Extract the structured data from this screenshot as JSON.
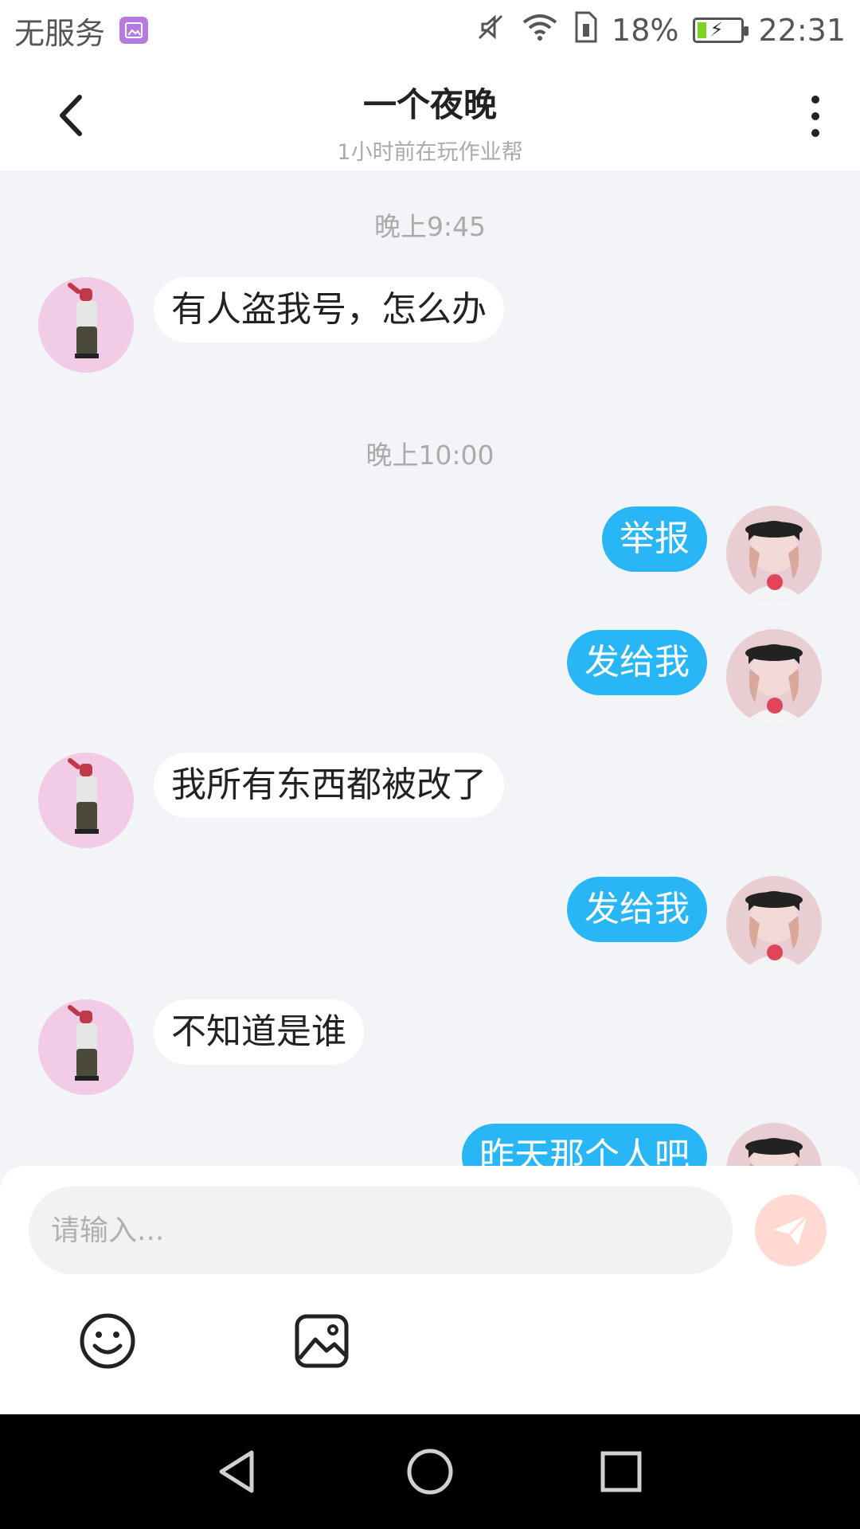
{
  "status_bar": {
    "carrier": "无服务",
    "battery": "18%",
    "time": "22:31",
    "battery_level": 0.18,
    "icons": [
      "gallery-icon",
      "mute-icon",
      "wifi-icon",
      "sim-icon",
      "battery-charging-icon"
    ]
  },
  "header": {
    "title": "一个夜晚",
    "subtitle": "1小时前在玩作业帮"
  },
  "messages": {
    "t1": {
      "time": "晚上9:45"
    },
    "m1": {
      "text": "有人盗我号，怎么办"
    },
    "t2": {
      "time": "晚上10:00"
    },
    "m2": {
      "text": "举报"
    },
    "m3": {
      "text": "发给我"
    },
    "m4": {
      "text": "我所有东西都被改了"
    },
    "m5": {
      "text": "发给我"
    },
    "m6": {
      "text": "不知道是谁"
    },
    "m7": {
      "text": "昨天那个人吧"
    }
  },
  "composer": {
    "placeholder": "请输入...",
    "value": ""
  },
  "colors": {
    "sent_bubble": "#29b6f6",
    "received_bubble": "#ffffff",
    "chat_background": "#f3f4f7",
    "send_button": "#ffd9d2",
    "other_avatar_bg": "#f2cbe6"
  }
}
